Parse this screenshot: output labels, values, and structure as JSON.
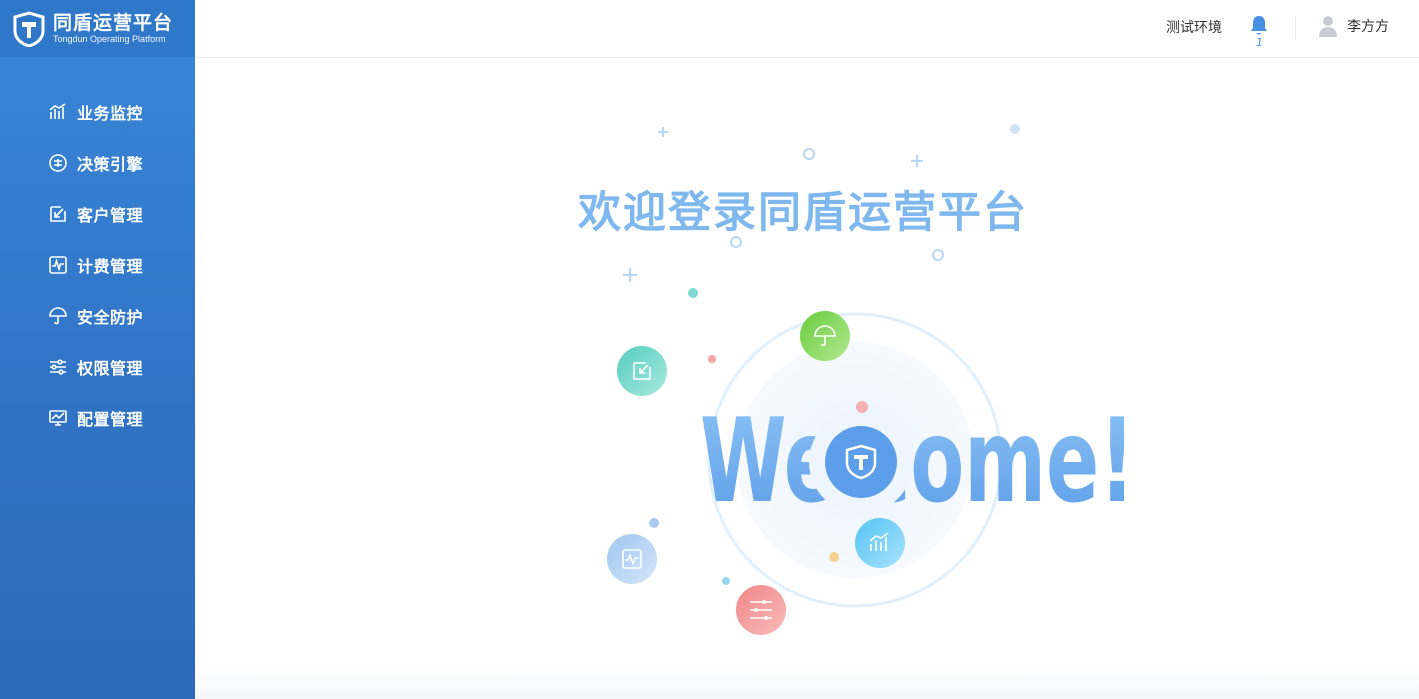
{
  "app": {
    "title": "同盾运营平台",
    "subtitle": "Tongdun Operating Platform"
  },
  "header": {
    "environment": "测试环境",
    "notification_count": "1",
    "user_name": "李方方"
  },
  "sidebar": {
    "items": [
      {
        "label": "业务监控",
        "icon": "chart-bars-icon"
      },
      {
        "label": "决策引擎",
        "icon": "decision-circle-icon"
      },
      {
        "label": "客户管理",
        "icon": "customer-arrow-icon"
      },
      {
        "label": "计费管理",
        "icon": "billing-pulse-icon"
      },
      {
        "label": "安全防护",
        "icon": "umbrella-icon"
      },
      {
        "label": "权限管理",
        "icon": "sliders-icon"
      },
      {
        "label": "配置管理",
        "icon": "monitor-icon"
      }
    ]
  },
  "main": {
    "welcome_title": "欢迎登录同盾运营平台",
    "welcome_word": "Welcome!"
  },
  "colors": {
    "sidebar": "#3074c6",
    "accent": "#4a90e2",
    "title": "#7fb8ee"
  }
}
